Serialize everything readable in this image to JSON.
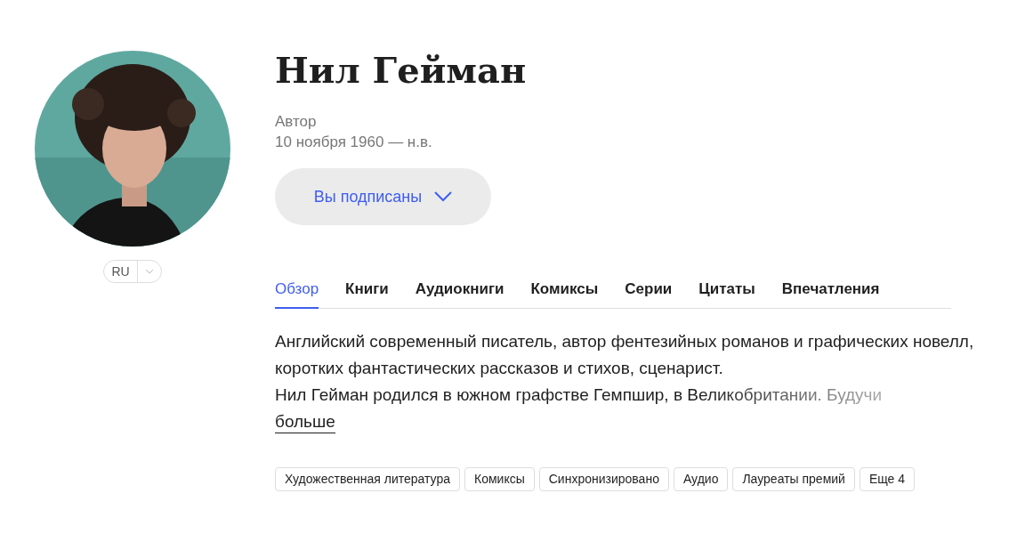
{
  "author": {
    "name": "Нил Гейман",
    "role": "Автор",
    "dates": "10 ноября 1960 — н.в."
  },
  "language": {
    "code": "RU",
    "expanded": false
  },
  "subscribe_button": {
    "label": "Вы подписаны",
    "expanded": false
  },
  "tabs": [
    {
      "label": "Обзор",
      "selected": true
    },
    {
      "label": "Книги",
      "selected": false
    },
    {
      "label": "Аудиокниги",
      "selected": false
    },
    {
      "label": "Комиксы",
      "selected": false
    },
    {
      "label": "Серии",
      "selected": false
    },
    {
      "label": "Цитаты",
      "selected": false
    },
    {
      "label": "Впечатления",
      "selected": false
    }
  ],
  "description": {
    "lines": [
      "Английский современный писатель, автор фентезийных романов и графических новелл, коротких фантастических рассказов и стихов, сценарист.",
      "Нил Гейман родился в южном графстве Гемпшир, в Великобритании. Будучи"
    ],
    "more_link": "больше"
  },
  "tags": [
    "Художественная литература",
    "Комиксы",
    "Синхронизировано",
    "Аудио",
    "Лауреаты премий",
    "Еще 4"
  ]
}
